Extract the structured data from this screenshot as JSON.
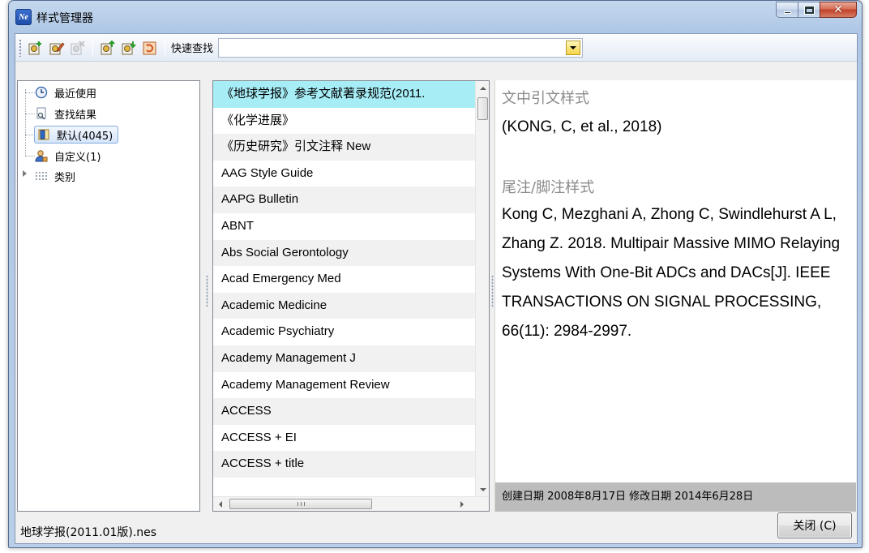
{
  "window": {
    "title": "样式管理器",
    "app_icon_text": "Ne"
  },
  "toolbar": {
    "buttons": [
      "new-style-icon",
      "edit-style-icon",
      "delete-style-icon",
      "import-style-icon",
      "export-style-icon",
      "refresh-style-icon"
    ],
    "quick_find_label": "快速查找",
    "quick_find_value": ""
  },
  "tree": {
    "items": [
      {
        "label": "最近使用",
        "icon": "clock-icon"
      },
      {
        "label": "查找结果",
        "icon": "search-doc-icon"
      },
      {
        "label": "默认(4045)",
        "icon": "folder-book-icon",
        "selected": true
      },
      {
        "label": "自定义(1)",
        "icon": "user-icon"
      },
      {
        "label": "类别",
        "icon": "grid-icon"
      }
    ]
  },
  "style_list": {
    "items": [
      "《地球学报》参考文献著录规范(2011.",
      "《化学进展》",
      "《历史研究》引文注释  New",
      "AAG Style Guide",
      "AAPG Bulletin",
      "ABNT",
      "Abs Social Gerontology",
      "Acad Emergency Med",
      "Academic Medicine",
      "Academic Psychiatry",
      "Academy Management J",
      "Academy Management Review",
      "ACCESS",
      "ACCESS + EI",
      "ACCESS + title"
    ],
    "selected_index": 0,
    "hscroll_grip": "III"
  },
  "preview": {
    "in_text_heading": "文中引文样式",
    "in_text_value": "(KONG, C, et al., 2018)",
    "endnote_heading": "尾注/脚注样式",
    "endnote_value": "Kong C, Mezghani A, Zhong C, Swindlehurst A L, Zhang Z. 2018. Multipair Massive MIMO Relaying Systems With One-Bit ADCs and DACs[J]. IEEE TRANSACTIONS ON SIGNAL PROCESSING, 66(11): 2984-2997.",
    "status": "创建日期  2008年8月17日  修改日期  2014年6月28日"
  },
  "footer": {
    "filename": "地球学报(2011.01版).nes",
    "close_label": "关闭 (C)"
  },
  "colors": {
    "selected_row": "#a7edf6",
    "status_bar": "#bcbcbc",
    "close_red": "#c2412a"
  }
}
